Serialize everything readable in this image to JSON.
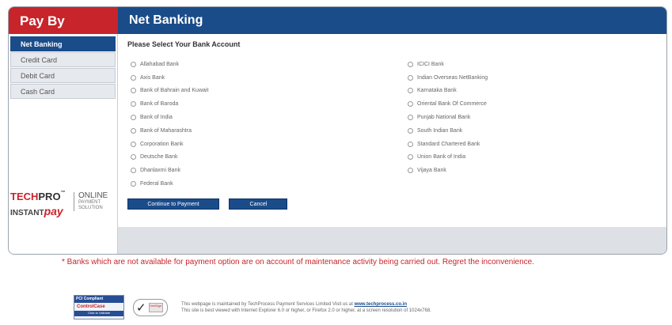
{
  "header": {
    "left_title": "Pay By",
    "right_title": "Net Banking"
  },
  "sidebar": {
    "tabs": [
      {
        "label": "Net Banking",
        "active": true
      },
      {
        "label": "Credit Card",
        "active": false
      },
      {
        "label": "Debit Card",
        "active": false
      },
      {
        "label": "Cash Card",
        "active": false
      }
    ]
  },
  "logo": {
    "tech": "TECH",
    "pro": "PRO",
    "tm": "™",
    "instant": "INSTANT",
    "pay": "pay",
    "online": "ONLINE",
    "payment": "PAYMENT",
    "solution": "SOLUTION"
  },
  "main": {
    "section_title": "Please Select Your Bank Account",
    "banks_col1": [
      "Allahabad Bank",
      "Axis Bank",
      "Bank of Bahrain and Kuwait",
      "Bank of Baroda",
      "Bank of India",
      "Bank of Maharashtra",
      "Corporation Bank",
      "Deutsche Bank",
      "Dhanlaxmi Bank",
      "Federal Bank"
    ],
    "banks_col2": [
      "ICICI Bank",
      "Indian Overseas NetBanking",
      "Karnataka Bank",
      "Oriental Bank Of Commerce",
      "Punjab National Bank",
      "South Indian Bank",
      "Standard Chartered Bank",
      "Union Bank of India",
      "Vijaya Bank"
    ],
    "continue_label": "Continue to Payment",
    "cancel_label": "Cancel"
  },
  "notice": "* Banks which are not available for payment option are on account of maintenance activity being carried out. Regret the inconvenience.",
  "footer": {
    "pci_label": "PCI Compliant",
    "control_case_a": "Control",
    "control_case_b": "Case",
    "click_validate": "Click to Validate",
    "seal_text": "VeriSign",
    "disclaimer_line1": "This webpage is maintained by TechProcess Payment Services Limited Visit us at",
    "disclaimer_link": "www.techprocess.co.in",
    "disclaimer_line2": "This site is best viewed with Internet Explorer 6.0 or higher, or Firefox 2.0 or higher, at a screen resolution of 1024x768."
  },
  "colors": {
    "brand_red": "#c8242b",
    "brand_blue": "#1a4c8a"
  }
}
